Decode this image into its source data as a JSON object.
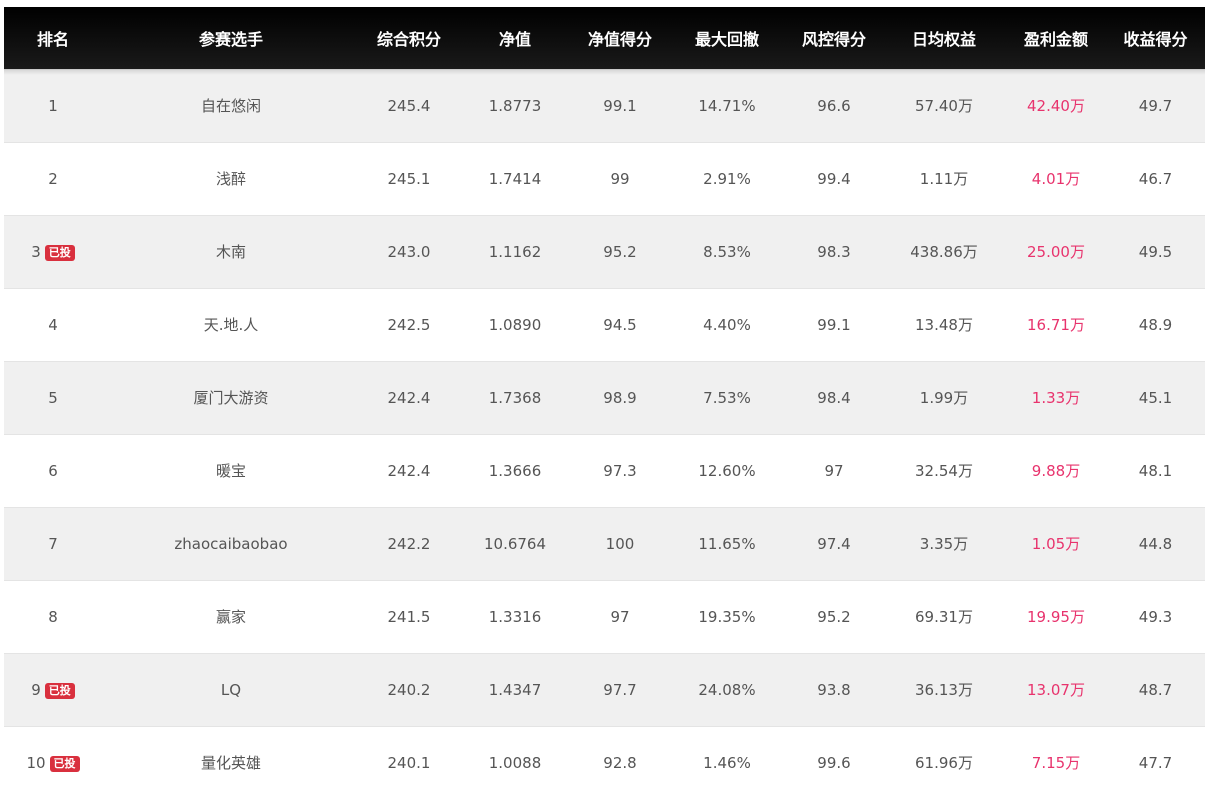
{
  "headers": [
    "排名",
    "参赛选手",
    "综合积分",
    "净值",
    "净值得分",
    "最大回撤",
    "风控得分",
    "日均权益",
    "盈利金额",
    "收益得分"
  ],
  "badge_label": "已投",
  "colors": {
    "header_bg": "#111111",
    "profit": "#e8336d",
    "badge": "#d9303e",
    "row_alt": "#f0f0f0"
  },
  "rows": [
    {
      "rank": "1",
      "badge": false,
      "name": "自在悠闲",
      "score": "245.4",
      "nav": "1.8773",
      "nav_score": "99.1",
      "drawdown": "14.71%",
      "risk_score": "96.6",
      "daily_equity": "57.40万",
      "profit": "42.40万",
      "return_score": "49.7"
    },
    {
      "rank": "2",
      "badge": false,
      "name": "浅醉",
      "score": "245.1",
      "nav": "1.7414",
      "nav_score": "99",
      "drawdown": "2.91%",
      "risk_score": "99.4",
      "daily_equity": "1.11万",
      "profit": "4.01万",
      "return_score": "46.7"
    },
    {
      "rank": "3",
      "badge": true,
      "name": "木南",
      "score": "243.0",
      "nav": "1.1162",
      "nav_score": "95.2",
      "drawdown": "8.53%",
      "risk_score": "98.3",
      "daily_equity": "438.86万",
      "profit": "25.00万",
      "return_score": "49.5"
    },
    {
      "rank": "4",
      "badge": false,
      "name": "天.地.人",
      "score": "242.5",
      "nav": "1.0890",
      "nav_score": "94.5",
      "drawdown": "4.40%",
      "risk_score": "99.1",
      "daily_equity": "13.48万",
      "profit": "16.71万",
      "return_score": "48.9"
    },
    {
      "rank": "5",
      "badge": false,
      "name": "厦门大游资",
      "score": "242.4",
      "nav": "1.7368",
      "nav_score": "98.9",
      "drawdown": "7.53%",
      "risk_score": "98.4",
      "daily_equity": "1.99万",
      "profit": "1.33万",
      "return_score": "45.1"
    },
    {
      "rank": "6",
      "badge": false,
      "name": "暖宝",
      "score": "242.4",
      "nav": "1.3666",
      "nav_score": "97.3",
      "drawdown": "12.60%",
      "risk_score": "97",
      "daily_equity": "32.54万",
      "profit": "9.88万",
      "return_score": "48.1"
    },
    {
      "rank": "7",
      "badge": false,
      "name": "zhaocaibaobao",
      "score": "242.2",
      "nav": "10.6764",
      "nav_score": "100",
      "drawdown": "11.65%",
      "risk_score": "97.4",
      "daily_equity": "3.35万",
      "profit": "1.05万",
      "return_score": "44.8"
    },
    {
      "rank": "8",
      "badge": false,
      "name": "赢家",
      "score": "241.5",
      "nav": "1.3316",
      "nav_score": "97",
      "drawdown": "19.35%",
      "risk_score": "95.2",
      "daily_equity": "69.31万",
      "profit": "19.95万",
      "return_score": "49.3"
    },
    {
      "rank": "9",
      "badge": true,
      "name": "LQ",
      "score": "240.2",
      "nav": "1.4347",
      "nav_score": "97.7",
      "drawdown": "24.08%",
      "risk_score": "93.8",
      "daily_equity": "36.13万",
      "profit": "13.07万",
      "return_score": "48.7"
    },
    {
      "rank": "10",
      "badge": true,
      "name": "量化英雄",
      "score": "240.1",
      "nav": "1.0088",
      "nav_score": "92.8",
      "drawdown": "1.46%",
      "risk_score": "99.6",
      "daily_equity": "61.96万",
      "profit": "7.15万",
      "return_score": "47.7"
    }
  ]
}
